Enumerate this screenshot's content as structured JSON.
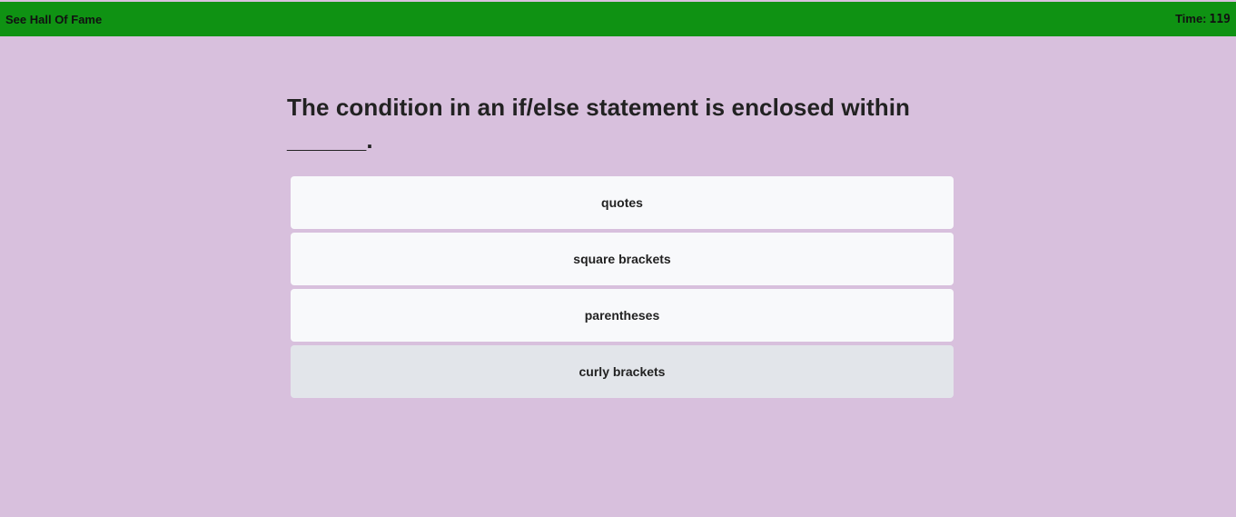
{
  "topbar": {
    "hall_of_fame_label": "See Hall Of Fame",
    "timer_label": "Time:",
    "timer_value": "119",
    "color": "#0f9213"
  },
  "quiz": {
    "question": "The condition in an if/else statement is enclosed within ______.",
    "choices": [
      {
        "label": "quotes"
      },
      {
        "label": "square brackets"
      },
      {
        "label": "parentheses"
      },
      {
        "label": "curly brackets"
      }
    ]
  },
  "colors": {
    "background": "#d8c0dd",
    "choice_bg": "#f8f9fb",
    "choice_hover_bg": "#e2e5ea"
  }
}
